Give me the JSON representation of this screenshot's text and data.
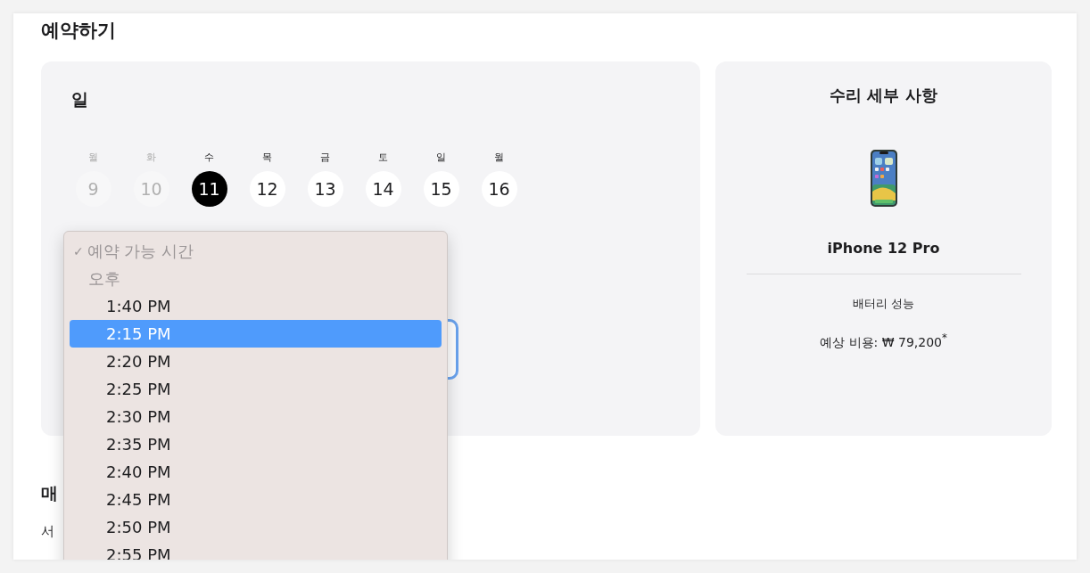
{
  "heading": "예약하기",
  "date_picker": {
    "title": "일",
    "days": [
      {
        "weekday": "월",
        "date": "9",
        "disabled": true,
        "selected": false
      },
      {
        "weekday": "화",
        "date": "10",
        "disabled": true,
        "selected": false
      },
      {
        "weekday": "수",
        "date": "11",
        "disabled": false,
        "selected": true
      },
      {
        "weekday": "목",
        "date": "12",
        "disabled": false,
        "selected": false
      },
      {
        "weekday": "금",
        "date": "13",
        "disabled": false,
        "selected": false
      },
      {
        "weekday": "토",
        "date": "14",
        "disabled": false,
        "selected": false
      },
      {
        "weekday": "일",
        "date": "15",
        "disabled": false,
        "selected": false
      },
      {
        "weekday": "월",
        "date": "16",
        "disabled": false,
        "selected": false
      }
    ]
  },
  "time_dropdown": {
    "prompt": {
      "check": "✓",
      "label": "예약 가능 시간",
      "checked": true
    },
    "group": "오후",
    "options": [
      {
        "label": "1:40 PM",
        "selected": false
      },
      {
        "label": "2:15 PM",
        "selected": true
      },
      {
        "label": "2:20 PM",
        "selected": false
      },
      {
        "label": "2:25 PM",
        "selected": false
      },
      {
        "label": "2:30 PM",
        "selected": false
      },
      {
        "label": "2:35 PM",
        "selected": false
      },
      {
        "label": "2:40 PM",
        "selected": false
      },
      {
        "label": "2:45 PM",
        "selected": false
      },
      {
        "label": "2:50 PM",
        "selected": false
      },
      {
        "label": "2:55 PM",
        "selected": false
      }
    ]
  },
  "repair_details": {
    "title": "수리 세부 사항",
    "device": "iPhone 12 Pro",
    "service": "배터리 성능",
    "estimate": "예상 비용: ₩ 79,200$^{*}$"
  },
  "store": {
    "heading": "매",
    "address": "서"
  }
}
